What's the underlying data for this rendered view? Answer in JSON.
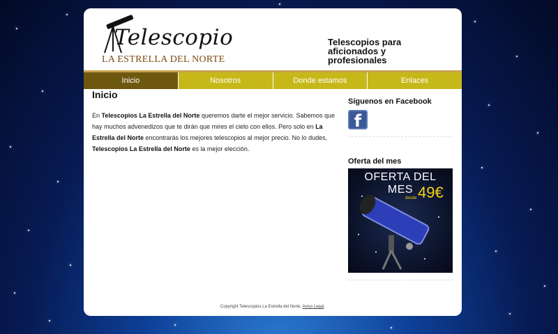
{
  "header": {
    "logo_script": "Telescopio",
    "logo_sub": "LA ESTRELLA DEL NORTE",
    "tagline": "Telescopios para aficionados y profesionales"
  },
  "nav": {
    "items": [
      "Inicio",
      "Nosotros",
      "Donde estamos",
      "Enlaces"
    ],
    "active": "Inicio"
  },
  "main": {
    "title": "Inicio",
    "p_1": "En ",
    "p_b1": "Telescopios La Estrella del Norte",
    "p_2": " queremos darte el mejor servicio. Sabemos que hay muchos advenedizos que te dirán que mires el cielo con ellos. Pero solo en ",
    "p_b2": "La Estrella del Norte",
    "p_3": " encontrarás los mejores telescopios al mejor precio. No lo dudes, ",
    "p_b3": "Telescopios La Estrella del Norte",
    "p_4": " es la mejor elección."
  },
  "sidebar": {
    "facebook_title": "Síguenos en Facebook",
    "facebook_icon": "facebook-icon",
    "offer_title": "Oferta del mes",
    "offer_banner": {
      "heading": "OFERTA DEL MES",
      "desde": "desde",
      "price": "49€"
    }
  },
  "footer": {
    "copyright": "Copyright Telescopios La Estrella del Norte.",
    "legal_link": "Aviso Legal",
    "legal_tail": "."
  },
  "colors": {
    "nav_bg": "#c7b81a",
    "nav_active": "#6e5810",
    "nav_border": "#c9a24c",
    "offer_price": "#f4d31a",
    "facebook_blue": "#3b5998"
  }
}
